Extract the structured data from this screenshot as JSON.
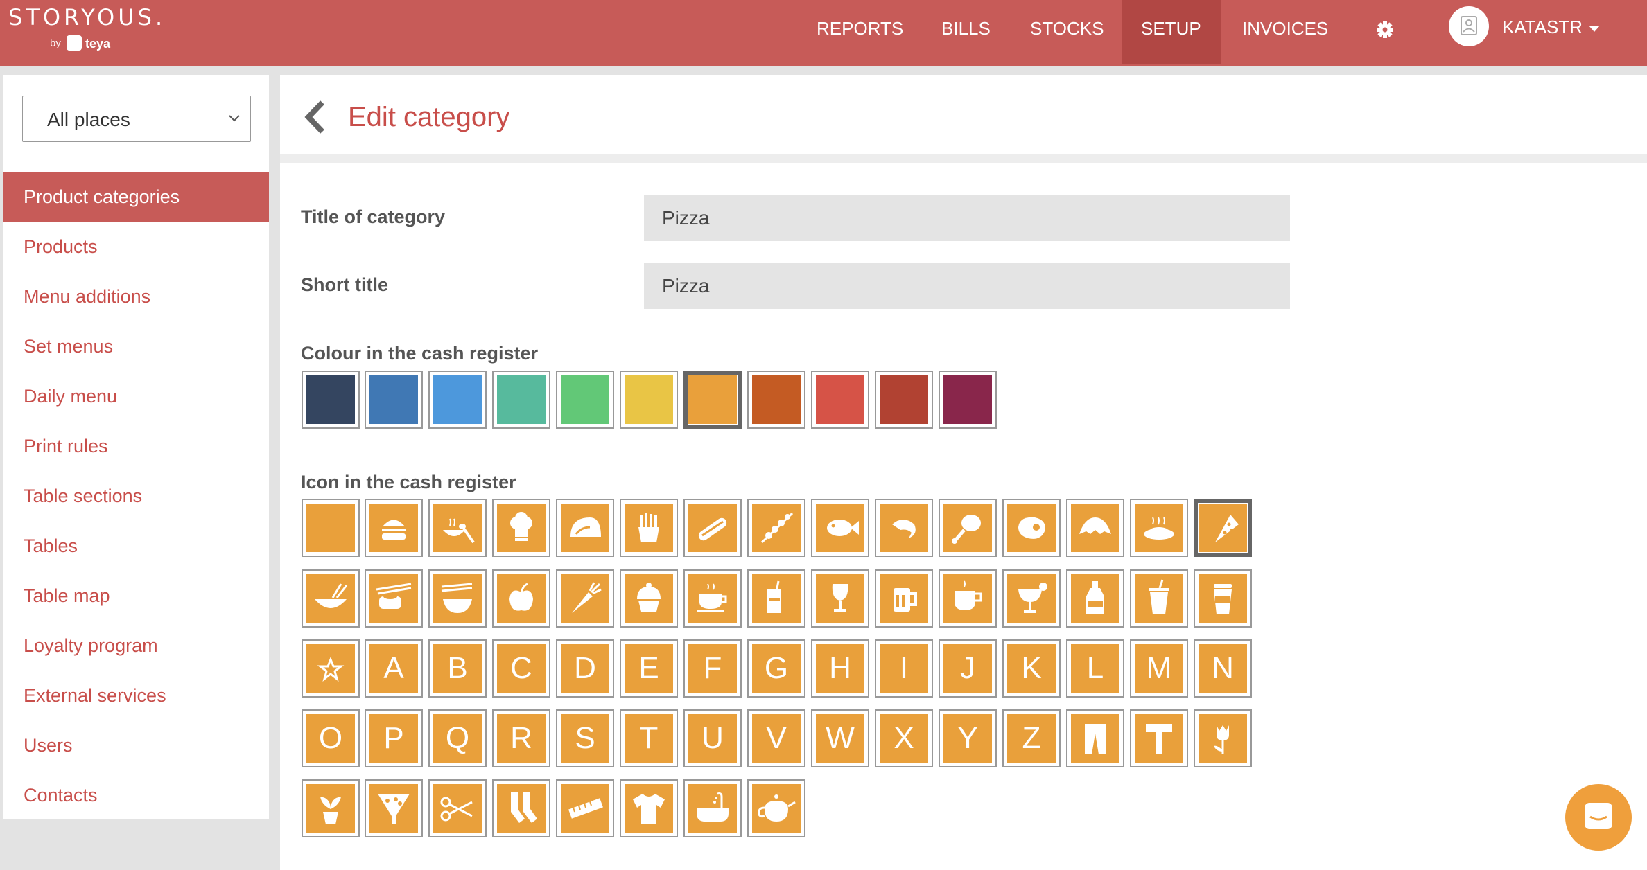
{
  "topbar": {
    "brand": "STORYOUS.",
    "by": "by",
    "teya": "teya",
    "nav": [
      {
        "label": "REPORTS"
      },
      {
        "label": "BILLS"
      },
      {
        "label": "STOCKS"
      },
      {
        "label": "SETUP",
        "active": true
      },
      {
        "label": "INVOICES"
      }
    ],
    "user": "KATASTR",
    "accent": "#c75b58"
  },
  "sidebar": {
    "place_select": "All places",
    "items": [
      "Product categories",
      "Products",
      "Menu additions",
      "Set menus",
      "Daily menu",
      "Print rules",
      "Table sections",
      "Tables",
      "Table map",
      "Loyalty program",
      "External services",
      "Users",
      "Contacts"
    ],
    "active_index": 0
  },
  "page": {
    "title": "Edit category",
    "fields": [
      {
        "label": "Title of category",
        "value": "Pizza"
      },
      {
        "label": "Short title",
        "value": "Pizza"
      }
    ],
    "colour_label": "Colour in the cash register",
    "colours": [
      "#344560",
      "#4078b4",
      "#4d98dc",
      "#57ba9d",
      "#62c877",
      "#e9c545",
      "#e9a03b",
      "#c45b23",
      "#d65347",
      "#b14232",
      "#89264b"
    ],
    "selected_colour": 6,
    "icon_label": "Icon in the cash register",
    "icons": [
      [
        "blank",
        "burger-icon",
        "bowl-spoon-icon",
        "chef-hat-icon",
        "taco-icon",
        "fries-icon",
        "hotdog-icon",
        "skewer-icon",
        "fish-icon",
        "shrimp-icon",
        "drumstick-icon",
        "steak-icon",
        "croissant-icon",
        "pasta-icon",
        "pizza-icon"
      ],
      [
        "salad-icon",
        "sushi-icon",
        "noodles-icon",
        "apple-icon",
        "carrot-icon",
        "cupcake-icon",
        "tea-icon",
        "juice-icon",
        "wine-icon",
        "beer-icon",
        "coffee-icon",
        "cocktail-icon",
        "bottle-icon",
        "soda-cup-icon",
        "takeaway-coffee-icon"
      ],
      [
        "star-icon",
        "A",
        "B",
        "C",
        "D",
        "E",
        "F",
        "G",
        "H",
        "I",
        "J",
        "K",
        "L",
        "M",
        "N"
      ],
      [
        "O",
        "P",
        "Q",
        "R",
        "S",
        "T",
        "U",
        "V",
        "W",
        "X",
        "Y",
        "Z",
        "trousers-icon",
        "hammer-icon",
        "tulip-icon"
      ],
      [
        "plant-icon",
        "funnel-icon",
        "scissors-icon",
        "socks-icon",
        "ruler-icon",
        "tshirt-icon",
        "bathtub-icon",
        "teapot-icon"
      ]
    ],
    "selected_icon": "pizza-icon"
  }
}
